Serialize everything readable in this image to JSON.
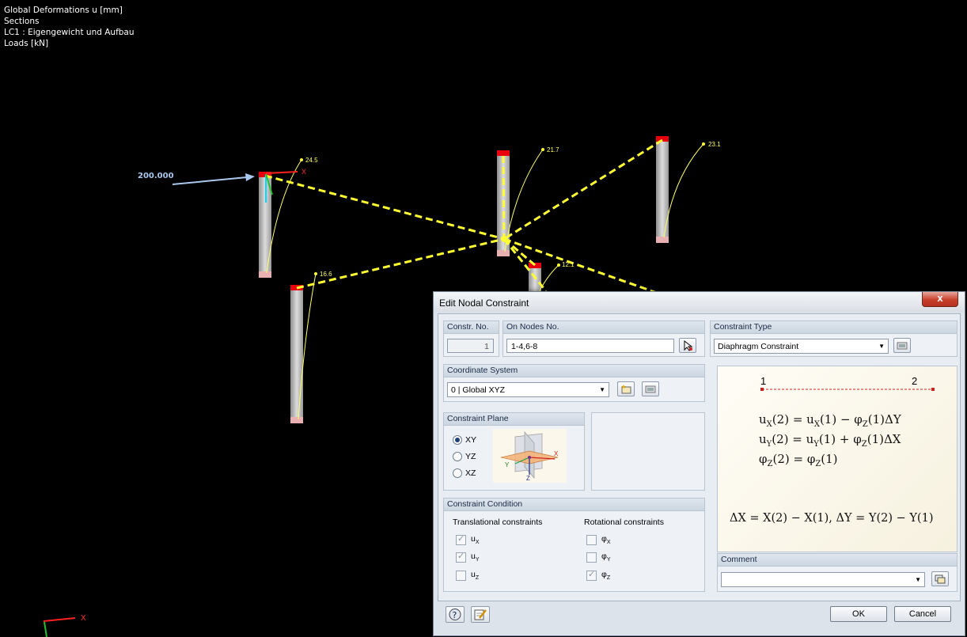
{
  "viewport": {
    "info_lines": [
      "Global Deformations u [mm]",
      "Sections",
      "LC1 : Eigengewicht und Aufbau",
      "Loads [kN]"
    ],
    "load_value": "200.000",
    "node_labels": [
      "24.5",
      "21.7",
      "23.1",
      "16.6",
      "12.1"
    ],
    "axis_label_x": "X",
    "axis_label_x2": "X",
    "colors": {
      "background": "#000000",
      "diaphragm_lines": "#ffff33",
      "column": "#c8c8c8",
      "column_top": "#e8000c",
      "load_arrow": "#aac8ee"
    }
  },
  "dialog": {
    "title": "Edit Nodal Constraint",
    "close_label": "x",
    "constr_no": {
      "label": "Constr. No.",
      "value": "1"
    },
    "on_nodes": {
      "label": "On Nodes No.",
      "value": "1-4,6-8"
    },
    "constraint_type": {
      "label": "Constraint Type",
      "value": "Diaphragm Constraint"
    },
    "coordinate_system": {
      "label": "Coordinate System",
      "value": "0 | Global XYZ"
    },
    "constraint_plane": {
      "label": "Constraint Plane",
      "options": [
        "XY",
        "YZ",
        "XZ"
      ],
      "selected": "XY",
      "axis_x": "X",
      "axis_y": "Y",
      "axis_z": "Z"
    },
    "preview": {
      "node1": "1",
      "node2": "2",
      "eq1_a": "u",
      "eq1_as": "X",
      "eq1_b": "(2) = u",
      "eq1_bs": "X",
      "eq1_c": "(1) − φ",
      "eq1_cs": "Z",
      "eq1_d": "(1)ΔY",
      "eq2_a": "u",
      "eq2_as": "Y",
      "eq2_b": "(2) = u",
      "eq2_bs": "Y",
      "eq2_c": "(1) + φ",
      "eq2_cs": "Z",
      "eq2_d": "(1)ΔX",
      "eq3_a": "φ",
      "eq3_as": "Z",
      "eq3_b": "(2) = φ",
      "eq3_bs": "Z",
      "eq3_c": "(1)",
      "eq4": "ΔX = X(2) − X(1), ΔY = Y(2) − Y(1)"
    },
    "constraint_condition": {
      "label": "Constraint Condition",
      "translational_header": "Translational constraints",
      "rotational_header": "Rotational constraints",
      "translational": [
        {
          "base": "u",
          "sub": "X",
          "checked": true
        },
        {
          "base": "u",
          "sub": "Y",
          "checked": true
        },
        {
          "base": "u",
          "sub": "Z",
          "checked": false
        }
      ],
      "rotational": [
        {
          "base": "φ",
          "sub": "X",
          "checked": false
        },
        {
          "base": "φ",
          "sub": "Y",
          "checked": false
        },
        {
          "base": "φ",
          "sub": "Z",
          "checked": true
        }
      ]
    },
    "comment": {
      "label": "Comment",
      "value": ""
    },
    "ok_label": "OK",
    "cancel_label": "Cancel"
  }
}
